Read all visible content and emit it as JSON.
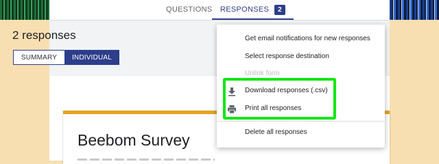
{
  "tabs": {
    "questions_label": "QUESTIONS",
    "responses_label": "RESPONSES",
    "responses_count": "2"
  },
  "summary": {
    "title": "2 responses",
    "summary_label": "SUMMARY",
    "individual_label": "INDIVIDUAL"
  },
  "form": {
    "title": "Beebom Survey",
    "accent_color": "#e6a21b"
  },
  "menu": {
    "items": [
      {
        "label": "Get email notifications for new responses",
        "icon": null,
        "enabled": true
      },
      {
        "label": "Select response destination",
        "icon": null,
        "enabled": true
      },
      {
        "label": "Unlink form",
        "icon": null,
        "enabled": false
      },
      {
        "label": "Download responses (.csv)",
        "icon": "download-icon",
        "enabled": true
      },
      {
        "label": "Print all responses",
        "icon": "print-icon",
        "enabled": true
      },
      {
        "label": "Delete all responses",
        "icon": null,
        "enabled": true
      }
    ]
  },
  "colors": {
    "brand": "#2d3e8a",
    "highlight": "#14e614",
    "page_background": "#f8dfb1"
  }
}
